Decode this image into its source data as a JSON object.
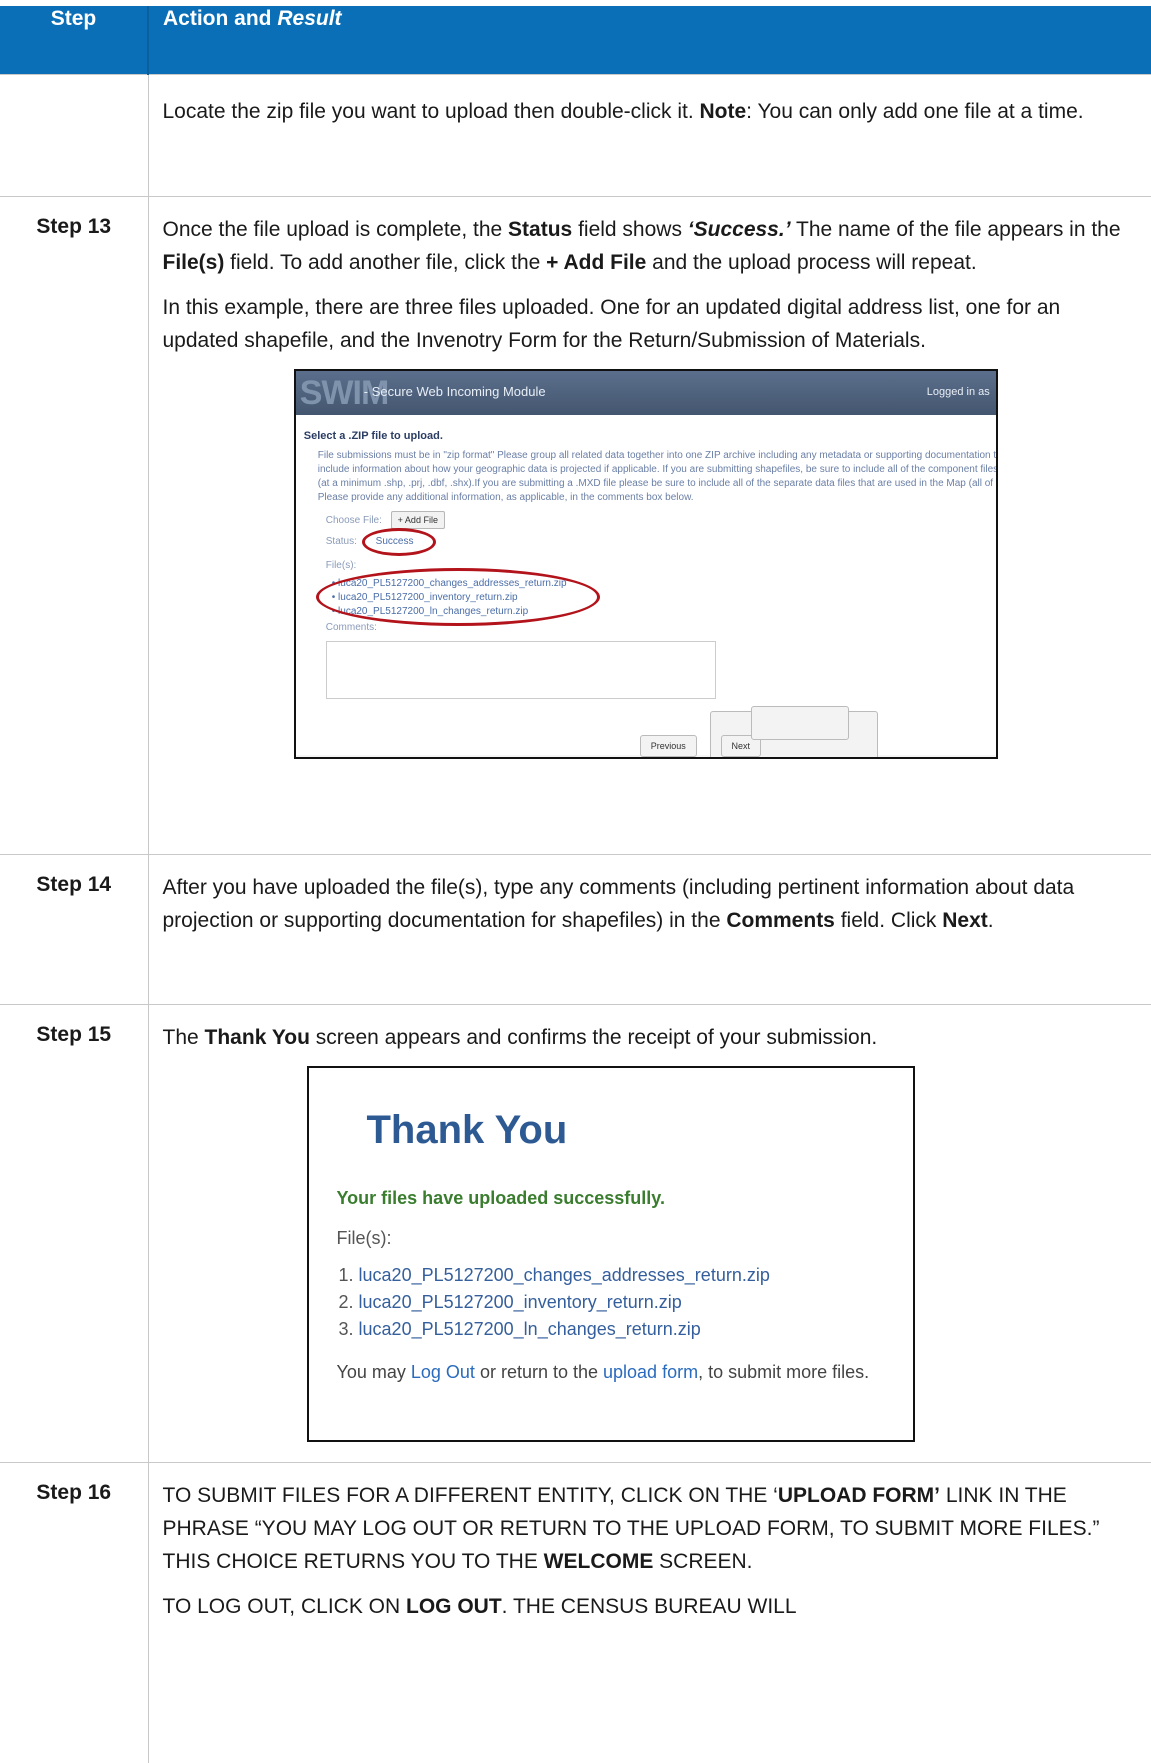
{
  "header": {
    "step": "Step",
    "action": "Action and",
    "result": "Result"
  },
  "rows": {
    "r0": {
      "step": "",
      "t1": "Locate the zip file you want to upload then double-click it. ",
      "t2": "Note",
      "t3": ": You can only add one file at a time."
    },
    "r13": {
      "step": "Step 13",
      "a1": "Once the file upload is complete, the ",
      "a2": "Status",
      "a3": " field shows ",
      "a4": "‘Success.’",
      "a5": " The name of the file appears in the ",
      "a6": "File(s)",
      "a7": " field. To add another file, click the ",
      "a8": "+ Add File",
      "a9": " and the upload process will repeat.",
      "b1": "In this example, there are three files uploaded. One for an updated digital address list, one for an updated shapefile, and the Invenotry Form for the Return/Submission of Materials."
    },
    "r14": {
      "step": "Step 14",
      "a1": "After you have uploaded the file(s), type any comments (including pertinent information about data projection or supporting documentation for shapefiles) in the ",
      "a2": "Comments",
      "a3": " field. Click ",
      "a4": "Next",
      "a5": "."
    },
    "r15": {
      "step": "Step 15",
      "a1": "The ",
      "a2": "Thank You",
      "a3": " screen appears and confirms the receipt of your submission."
    },
    "r16": {
      "step": "Step 16",
      "a1": "TO SUBMIT FILES FOR A DIFFERENT ENTITY, CLICK ON THE ‘",
      "a2": "UPLOAD FORM’",
      "a3": " LINK IN THE PHRASE “YOU MAY LOG OUT OR RETURN TO THE UPLOAD FORM, TO SUBMIT MORE FILES.” THIS CHOICE RETURNS YOU TO THE ",
      "a4": "WELCOME",
      "a5": " SCREEN.",
      "b1": "TO LOG OUT, CLICK ON ",
      "b2": "LOG OUT",
      "b3": ". THE CENSUS BUREAU WILL"
    }
  },
  "swim": {
    "logo": "SWIM",
    "title": "- Secure Web Incoming Module",
    "logged_in": "Logged in as",
    "heading": "Select a .ZIP file to upload.",
    "desc": [
      "File submissions must be in \"zip format\" Please group all related data together into one ZIP archive including any metadata or supporting documentation that",
      "include information about how your geographic data is projected if applicable. If you are submitting shapefiles, be sure to include all of the component files ne",
      "(at a minimum .shp, .prj, .dbf, .shx).If you are submitting a .MXD file please be sure to include all of the separate data files that are used in the Map (all of the",
      "Please provide any additional information, as applicable, in the comments box below."
    ],
    "choose_label": "Choose File:",
    "add_file": "+ Add File",
    "status_label": "Status:",
    "status_value": "Success",
    "files_label": "File(s):",
    "files": [
      "• luca20_PL5127200_changes_addresses_return.zip",
      "• luca20_PL5127200_inventory_return.zip",
      "• luca20_PL5127200_ln_changes_return.zip"
    ],
    "comments_label": "Comments:",
    "prev": "Previous",
    "next": "Next"
  },
  "thanks": {
    "title": "Thank You",
    "ok": "Your files have uploaded successfully.",
    "files_label": "File(s):",
    "files": [
      {
        "n": "1.",
        "name": "luca20_PL5127200_changes_addresses_return.zip"
      },
      {
        "n": "2.",
        "name": "luca20_PL5127200_inventory_return.zip"
      },
      {
        "n": "3.",
        "name": "luca20_PL5127200_ln_changes_return.zip"
      }
    ],
    "foot1": "You may ",
    "logout": "Log Out",
    "foot2": " or return to the ",
    "upload": "upload form",
    "foot3": ", to submit more files."
  }
}
